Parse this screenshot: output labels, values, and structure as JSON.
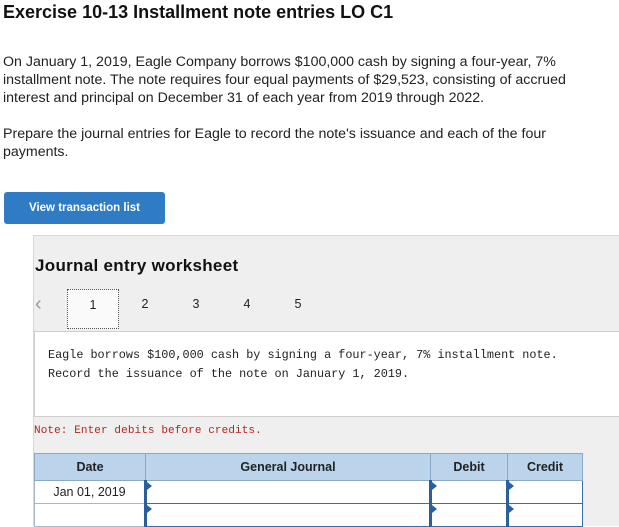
{
  "header": {
    "title": "Exercise 10-13 Installment note entries LO C1"
  },
  "problem": {
    "paragraph1": "On January 1, 2019, Eagle Company borrows $100,000 cash by signing a four-year, 7% installment note. The note requires four equal payments of $29,523, consisting of accrued interest and principal on December 31 of each year from 2019 through 2022.",
    "paragraph2": "Prepare the journal entries for Eagle to record the note's issuance and each of the four payments."
  },
  "buttons": {
    "view_transaction_list": "View transaction list"
  },
  "worksheet": {
    "title": "Journal entry worksheet",
    "prev_icon": "chevron-left-icon",
    "pages": [
      "1",
      "2",
      "3",
      "4",
      "5"
    ],
    "active_page": 1,
    "description_line1": "Eagle borrows $100,000 cash by signing a four-year, 7% installment note.",
    "description_line2": "Record the issuance of the note on January 1, 2019.",
    "note": "Note: Enter debits before credits.",
    "table": {
      "headers": [
        "Date",
        "General Journal",
        "Debit",
        "Credit"
      ],
      "rows": [
        {
          "date": "Jan 01, 2019",
          "account": "",
          "debit": "",
          "credit": ""
        },
        {
          "date": "",
          "account": "",
          "debit": "",
          "credit": ""
        }
      ]
    }
  },
  "colors": {
    "button_blue": "#2f7bc4",
    "header_blue": "#bcd3ec",
    "note_red": "#b3261e",
    "panel_gray": "#efefef"
  }
}
